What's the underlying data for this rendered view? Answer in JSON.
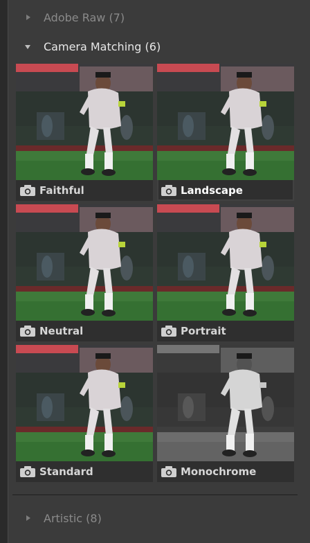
{
  "groups": {
    "adobe_raw": {
      "label": "Adobe Raw (7)",
      "expanded": false
    },
    "camera_matching": {
      "label": "Camera Matching (6)",
      "expanded": true
    },
    "artistic": {
      "label": "Artistic (8)",
      "expanded": false
    }
  },
  "profiles": [
    {
      "label": "Faithful",
      "selected": false,
      "mono": false
    },
    {
      "label": "Landscape",
      "selected": true,
      "mono": false
    },
    {
      "label": "Neutral",
      "selected": false,
      "mono": false
    },
    {
      "label": "Portrait",
      "selected": false,
      "mono": false
    },
    {
      "label": "Standard",
      "selected": false,
      "mono": false
    },
    {
      "label": "Monochrome",
      "selected": false,
      "mono": true
    }
  ],
  "icons": {
    "profile_badge": "camera-icon",
    "collapsed": "triangle-right-icon",
    "expanded": "triangle-down-icon"
  },
  "colors": {
    "panel_bg": "#3b3b3b",
    "selection_outline": "#e6e6e6",
    "label_dim": "#8a8a8a",
    "label_bright": "#e8e8e8"
  }
}
